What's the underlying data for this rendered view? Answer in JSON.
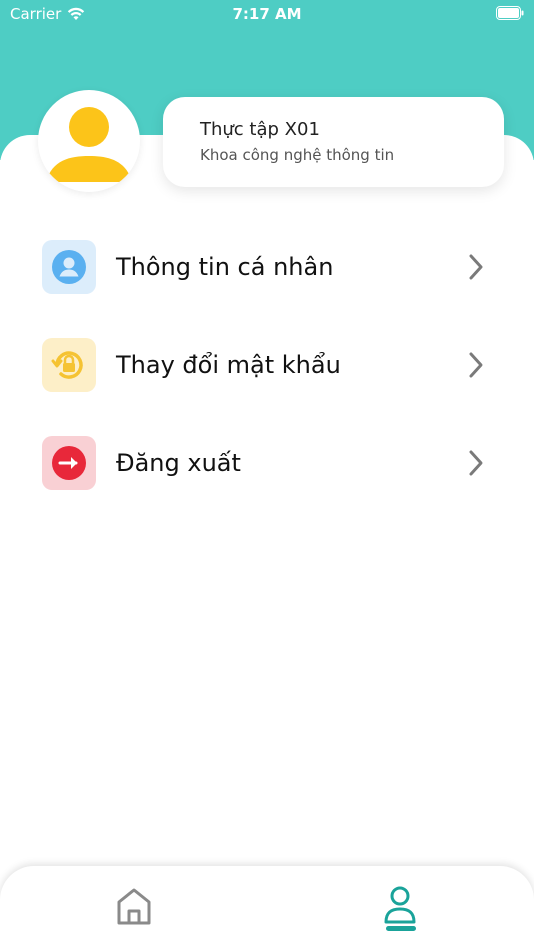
{
  "status_bar": {
    "carrier": "Carrier",
    "time": "7:17 AM"
  },
  "profile": {
    "name": "Thực tập X01",
    "department": "Khoa công nghệ thông tin"
  },
  "menu": [
    {
      "label": "Thông tin cá nhân",
      "icon": "user-circle-icon",
      "color": "#5ab0f0",
      "bg": "#dcedfb"
    },
    {
      "label": "Thay đổi mật khẩu",
      "icon": "lock-reset-icon",
      "color": "#f5c333",
      "bg": "#fdefc8"
    },
    {
      "label": "Đăng xuất",
      "icon": "logout-icon",
      "color": "#e8283a",
      "bg": "#f9d0d4"
    }
  ],
  "tabs": [
    {
      "icon": "home-icon",
      "active": false
    },
    {
      "icon": "user-icon",
      "active": true
    }
  ],
  "colors": {
    "header": "#4ecdc4",
    "accent": "#1aa39a",
    "avatar": "#fcc419"
  }
}
